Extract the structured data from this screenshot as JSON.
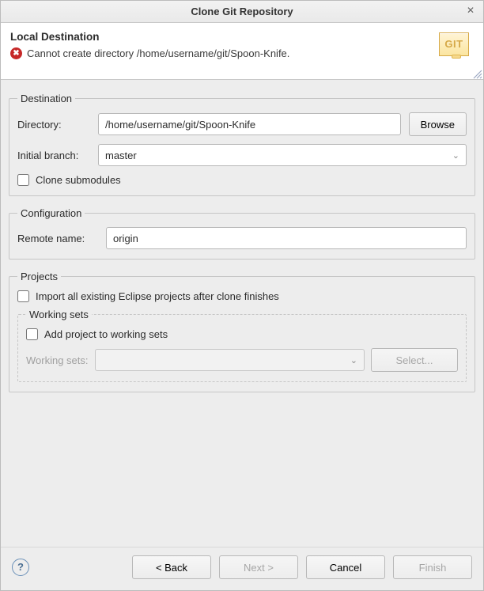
{
  "titlebar": {
    "title": "Clone Git Repository"
  },
  "banner": {
    "heading": "Local Destination",
    "error_msg": "Cannot create directory /home/username/git/Spoon-Knife.",
    "git_badge_text": "GIT"
  },
  "destination": {
    "legend": "Destination",
    "directory_label": "Directory:",
    "directory_value": "/home/username/git/Spoon-Knife",
    "browse_label": "Browse",
    "initial_branch_label": "Initial branch:",
    "initial_branch_value": "master",
    "clone_submodules_label": "Clone submodules"
  },
  "configuration": {
    "legend": "Configuration",
    "remote_name_label": "Remote name:",
    "remote_name_value": "origin"
  },
  "projects": {
    "legend": "Projects",
    "import_label": "Import all existing Eclipse projects after clone finishes",
    "working_sets_legend": "Working sets",
    "add_to_ws_label": "Add project to working sets",
    "ws_label": "Working sets:",
    "select_label": "Select..."
  },
  "footer": {
    "back_label": "< Back",
    "next_label": "Next >",
    "cancel_label": "Cancel",
    "finish_label": "Finish"
  }
}
